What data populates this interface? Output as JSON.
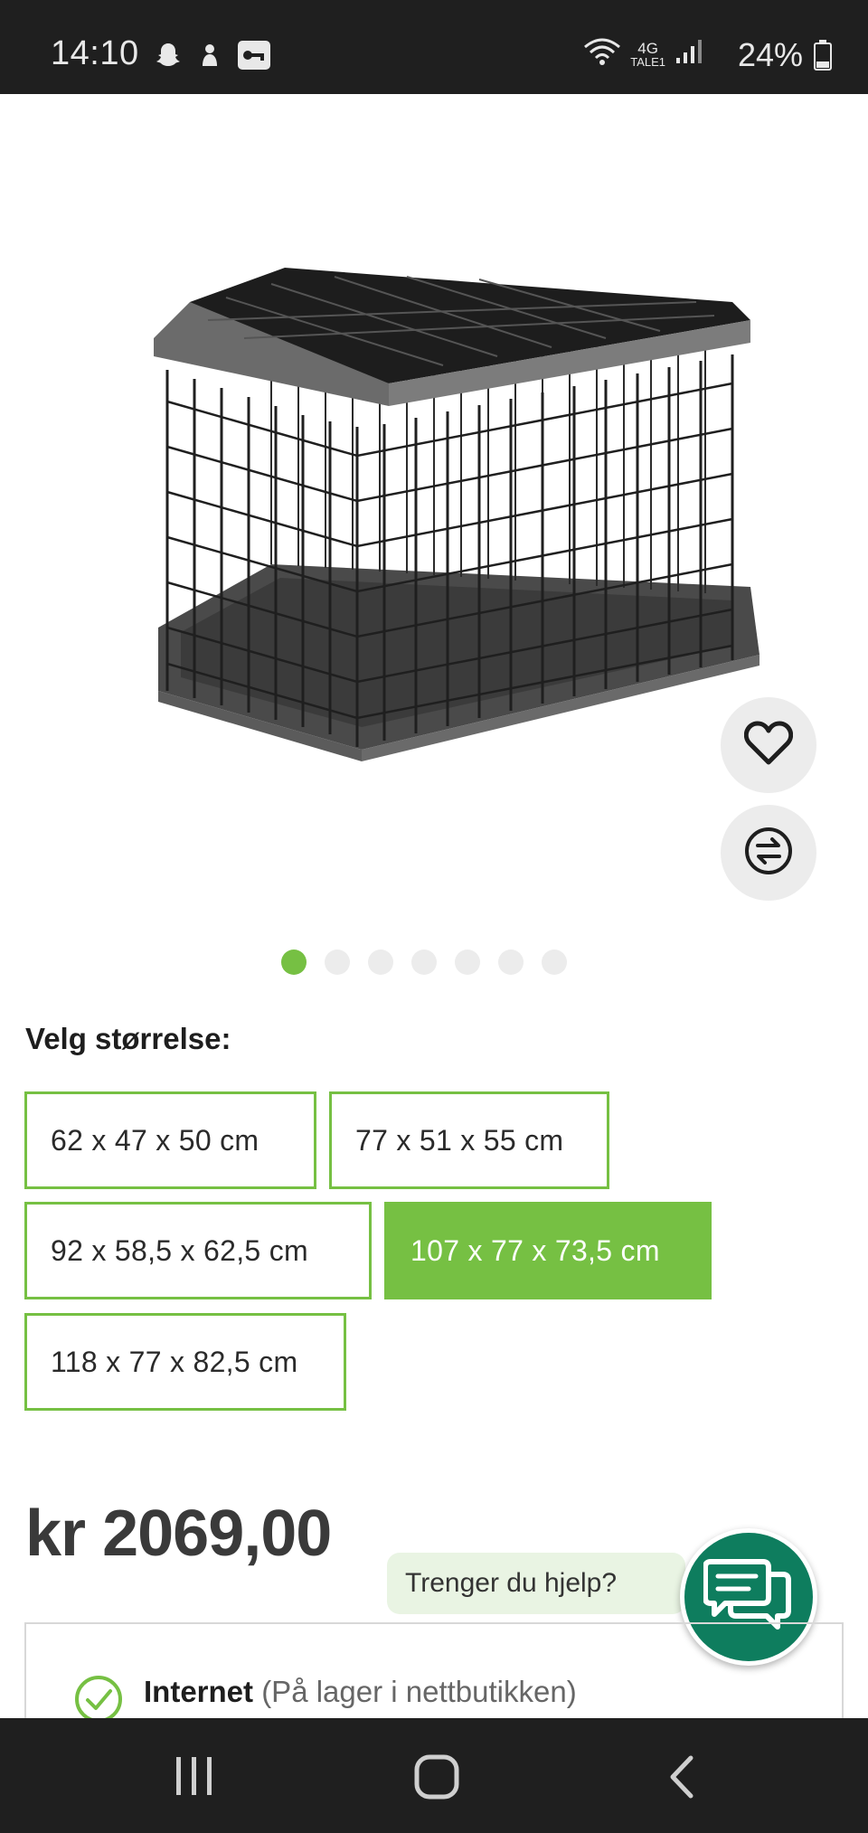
{
  "status_bar": {
    "time": "14:10",
    "network": "4G",
    "carrier": "TALE1",
    "battery": "24%",
    "icons": [
      "snapchat-icon",
      "ghost-icon",
      "key-icon",
      "wifi-icon",
      "signal-icon",
      "battery-icon"
    ]
  },
  "product": {
    "image_alt": "dog cage",
    "gallery_count": 7,
    "gallery_active_index": 0
  },
  "size_selector": {
    "label": "Velg størrelse:",
    "options": [
      "62 x 47 x 50 cm",
      "77 x 51 x 55 cm",
      "92 x 58,5 x 62,5 cm",
      "107 x 77 x 73,5 cm",
      "118 x 77 x 82,5 cm"
    ],
    "selected": "107 x 77 x 73,5 cm"
  },
  "price": "kr 2069,00",
  "help": {
    "bubble_text": "Trenger du hjelp?"
  },
  "stock": {
    "channel": "Internet",
    "detail": "(På lager i nettbutikken)"
  },
  "colors": {
    "accent": "#76c043",
    "chat": "#0e7d5e",
    "bar": "#1f1f1f"
  }
}
